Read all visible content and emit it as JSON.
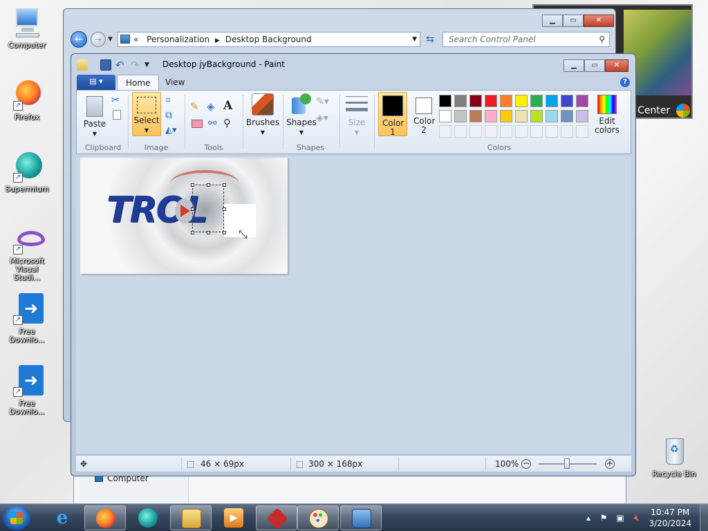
{
  "desktop": {
    "icons": [
      {
        "label": "Computer"
      },
      {
        "label": "Firefox"
      },
      {
        "label": "Supermium"
      },
      {
        "label": "Microsoft Visual Studi..."
      },
      {
        "label": "Free Downlo..."
      },
      {
        "label": "Free Downlo..."
      }
    ],
    "recycle_bin": "Recycle Bin"
  },
  "control_panel": {
    "breadcrumb": [
      "Personalization",
      "Desktop Background"
    ],
    "breadcrumb_prefix": "«",
    "search_placeholder": "Search Control Panel",
    "nav_tree_item": "Computer"
  },
  "gadget": {
    "label": "Center"
  },
  "paint": {
    "title": "Desktop jyBackground - Paint",
    "tabs": {
      "home": "Home",
      "view": "View"
    },
    "help": "?",
    "groups": {
      "clipboard": "Clipboard",
      "image": "Image",
      "tools": "Tools",
      "shapes": "Shapes",
      "colors": "Colors"
    },
    "buttons": {
      "paste": "Paste",
      "select": "Select",
      "brushes": "Brushes",
      "shapes": "Shapes",
      "size": "Size",
      "color1": "Color 1",
      "color2": "Color 2",
      "edit_colors": "Edit colors"
    },
    "palette_row1": [
      "#000000",
      "#7f7f7f",
      "#880015",
      "#ed1c24",
      "#ff7f27",
      "#fff200",
      "#22b14c",
      "#00a2e8",
      "#3f48cc",
      "#a349a4"
    ],
    "palette_row2": [
      "#ffffff",
      "#c3c3c3",
      "#b97a57",
      "#ffaec9",
      "#ffc90e",
      "#efe4b0",
      "#b5e61d",
      "#99d9ea",
      "#7092be",
      "#c8bfe7"
    ],
    "color1_value": "#000000",
    "color2_value": "#ffffff",
    "canvas_logo_text": "TROL",
    "status": {
      "selection_size": "46 × 69px",
      "image_size": "300 × 168px",
      "zoom": "100%",
      "zoom_level": 1.0
    }
  },
  "taskbar": {
    "time": "10:47 PM",
    "date": "3/20/2024"
  }
}
